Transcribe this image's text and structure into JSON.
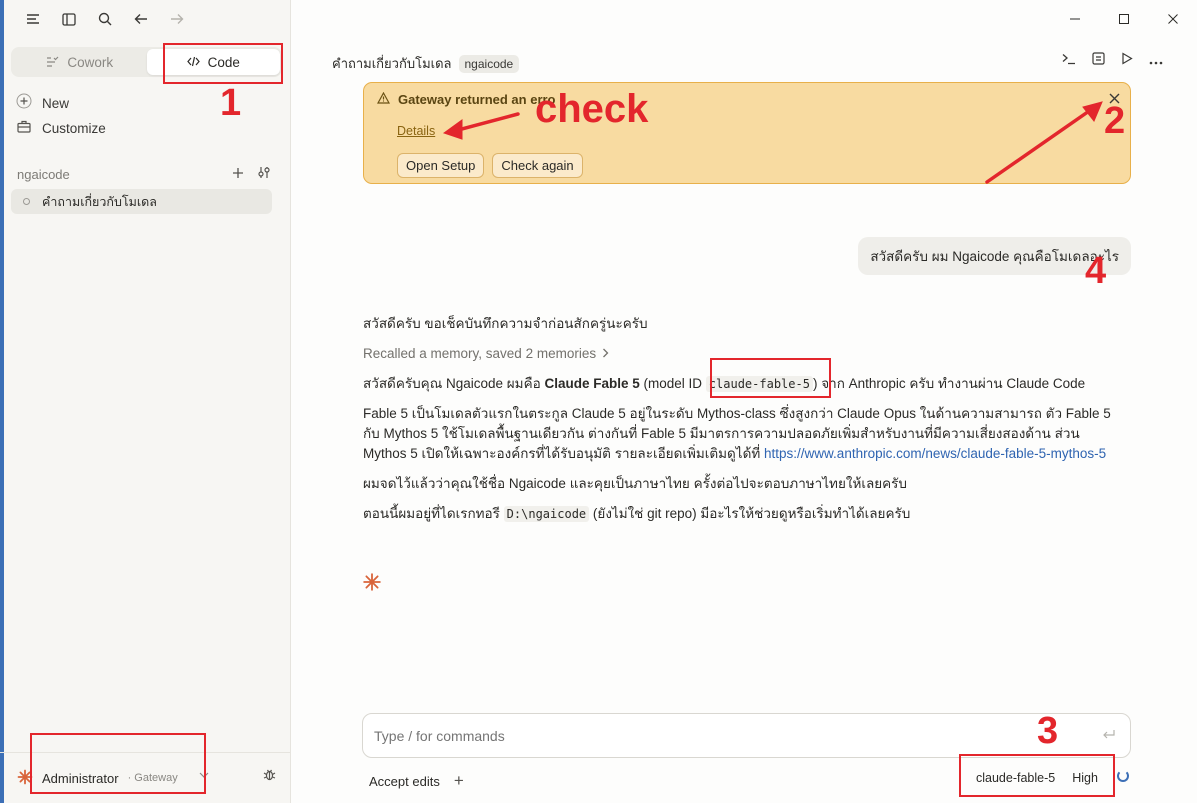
{
  "sidebar": {
    "top_icons": [
      "menu-icon",
      "sidebar-toggle-icon",
      "search-icon",
      "back-arrow-icon",
      "forward-arrow-icon"
    ],
    "modes": [
      {
        "label": "Cowork",
        "icon": "cowork-icon",
        "active": false
      },
      {
        "label": "Code",
        "icon": "code-icon",
        "active": true
      }
    ],
    "new_label": "New",
    "customize_label": "Customize",
    "project": {
      "name": "ngaicode",
      "sessions": [
        {
          "title": "คำถามเกี่ยวกับโมเดล"
        }
      ]
    },
    "user": {
      "name": "Administrator",
      "sub": "· Gateway"
    }
  },
  "window": {
    "controls": [
      "minimize-icon",
      "maximize-icon",
      "close-icon"
    ]
  },
  "header": {
    "title": "คำถามเกี่ยวกับโมเดล",
    "badge": "ngaicode",
    "actions": [
      "terminal-icon",
      "document-icon",
      "play-icon",
      "more-icon"
    ]
  },
  "alert": {
    "title": "Gateway returned an erro",
    "details_label": "Details",
    "buttons": [
      "Open Setup",
      "Check again"
    ]
  },
  "conversation": {
    "user_message": "สวัสดีครับ ผม Ngaicode คุณคือโมเดลอะไร",
    "reply": {
      "intro": "สวัสดีครับ ขอเช็คบันทึกความจำก่อนสักครู่นะครับ",
      "memory_note": "Recalled a memory, saved 2 memories",
      "p1_pre": "สวัสดีครับคุณ Ngaicode ผมคือ ",
      "p1_model": "Claude Fable 5",
      "p1_mid": " (model ID ",
      "p1_code": "claude-fable-5",
      "p1_post": ") จาก Anthropic ครับ ทำงานผ่าน Claude Code",
      "p2_text": "Fable 5 เป็นโมเดลตัวแรกในตระกูล Claude 5 อยู่ในระดับ Mythos-class ซึ่งสูงกว่า Claude Opus ในด้านความสามารถ ตัว Fable 5 กับ Mythos 5 ใช้โมเดลพื้นฐานเดียวกัน ต่างกันที่ Fable 5 มีมาตรการความปลอดภัยเพิ่มสำหรับงานที่มีความเสี่ยงสองด้าน ส่วน Mythos 5 เปิดให้เฉพาะองค์กรที่ได้รับอนุมัติ รายละเอียดเพิ่มเติมดูได้ที่ ",
      "p2_link": "https://www.anthropic.com/news/claude-fable-5-mythos-5",
      "p3": "ผมจดไว้แล้วว่าคุณใช้ชื่อ Ngaicode และคุยเป็นภาษาไทย ครั้งต่อไปจะตอบภาษาไทยให้เลยครับ",
      "p4_pre": "ตอนนี้ผมอยู่ที่ไดเรกทอรี ",
      "p4_code": "D:\\ngaicode",
      "p4_post": " (ยังไม่ใช่ git repo) มีอะไรให้ช่วยดูหรือเริ่มทำได้เลยครับ"
    }
  },
  "composer": {
    "placeholder": "Type / for commands",
    "accept_edits_label": "Accept edits",
    "add_label": "+",
    "model": "claude-fable-5",
    "effort": "High"
  },
  "annotations": {
    "n1": "1",
    "n2": "2",
    "n3": "3",
    "n4": "4",
    "check_word": "check",
    "color": "#e3262c"
  }
}
